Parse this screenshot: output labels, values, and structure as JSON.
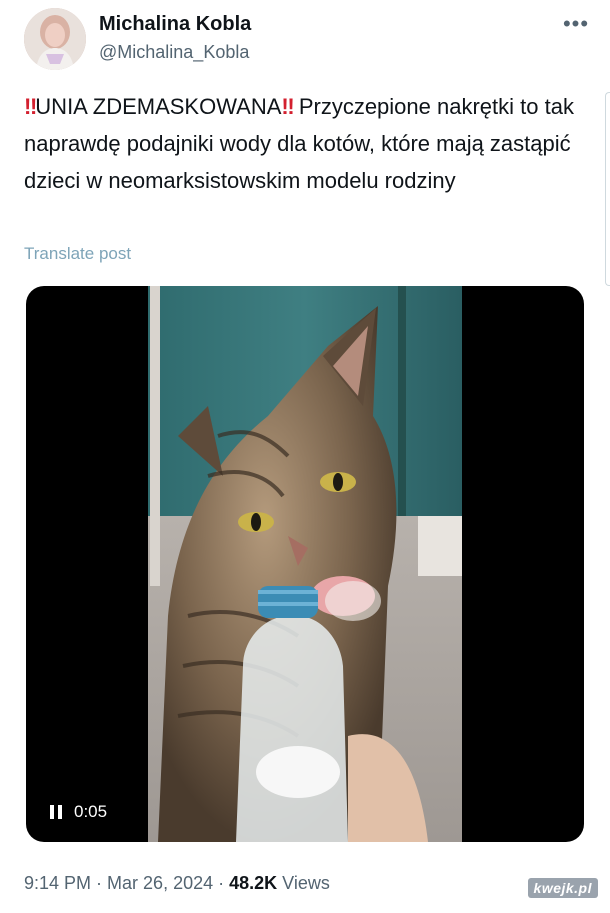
{
  "author": {
    "display_name": "Michalina Kobla",
    "handle": "@Michalina_Kobla",
    "avatar_icon": "profile-photo"
  },
  "more_icon": "more-horizontal-icon",
  "more_glyph": "•••",
  "tweet": {
    "emphasis_glyph_left": "‼",
    "headline": "UNIA ZDEMASKOWANA",
    "emphasis_glyph_right": "‼",
    "body": " Przyczepione nakrętki to tak naprawdę podajniki wody dla kotów, które mają zastąpić dzieci w neomarksistowskim modelu rodziny"
  },
  "translate_label": "Translate post",
  "video": {
    "time": "0:05",
    "control_icon": "pause-icon"
  },
  "meta": {
    "time": "9:14 PM",
    "separator1": " · ",
    "date": "Mar 26, 2024",
    "separator2": " · ",
    "views_count": "48.2K",
    "views_label": " Views"
  },
  "watermark": "kwejk.pl",
  "colors": {
    "text": "#0f1419",
    "secondary": "#536471",
    "link": "#7ea4b8",
    "emphasis": "#d3202f"
  }
}
